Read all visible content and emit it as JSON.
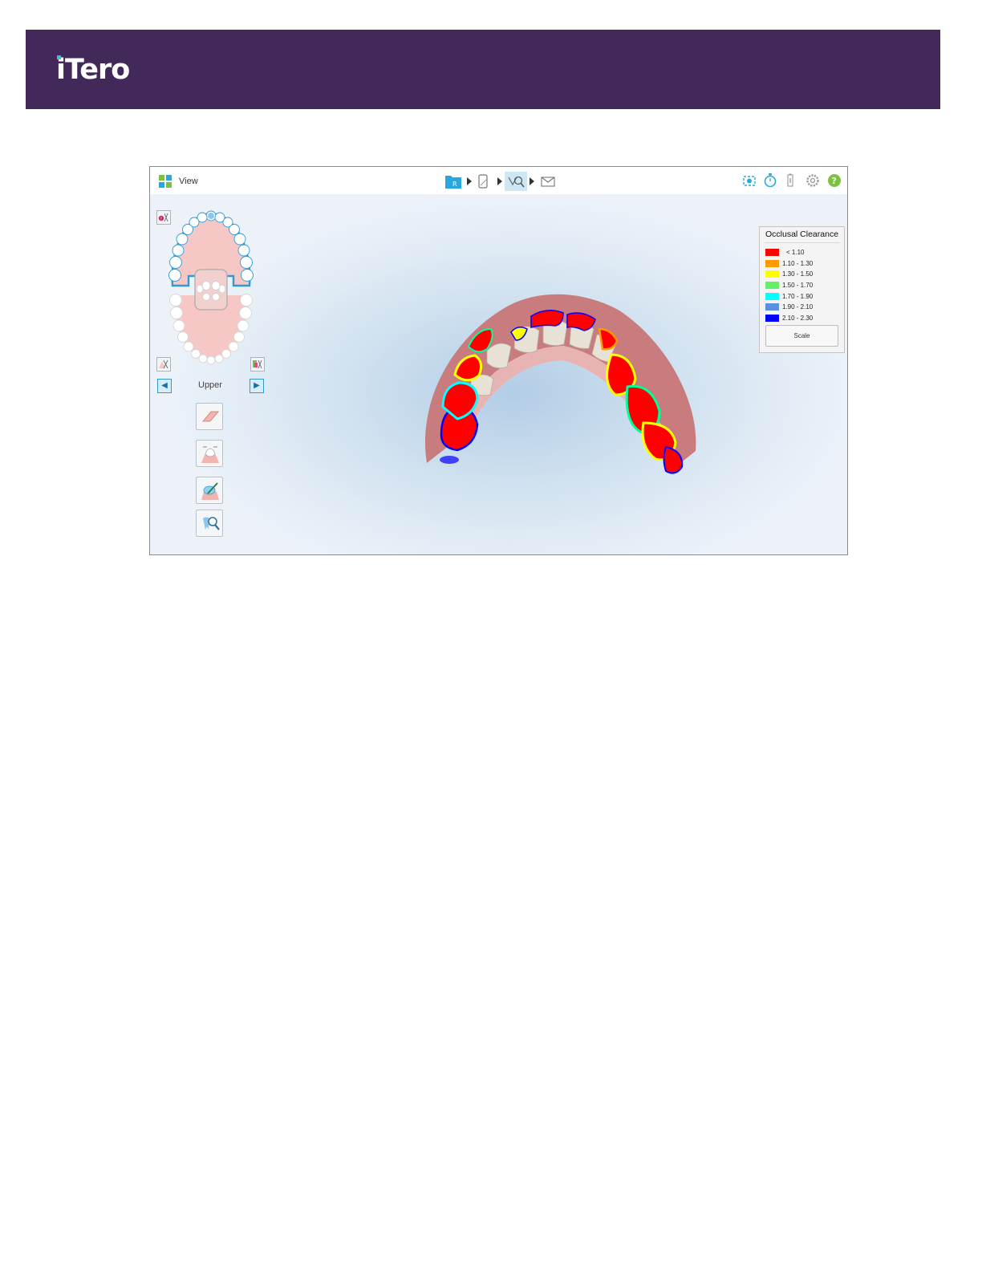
{
  "header": {
    "logo_text": "iTero",
    "background_color": "#43285a",
    "accent_color": "#2fc6d9"
  },
  "app": {
    "toolbar": {
      "view_label": "View",
      "workflow_steps": [
        "patient-folder-icon",
        "scan-icon",
        "view-tools-icon",
        "send-envelope-icon"
      ],
      "active_step": "view-tools-icon",
      "right_icons": [
        "camera-icon",
        "timer-icon",
        "battery-icon",
        "settings-gear-icon",
        "help-icon"
      ]
    },
    "jaw_navigator": {
      "jaw_label": "Upper",
      "selected_jaw": "upper"
    },
    "side_tools": [
      "eraser-tool-icon",
      "bite-view-tool-icon",
      "margin-tool-icon",
      "review-tool-icon"
    ],
    "legend": {
      "title": "Occlusal Clearance",
      "items": [
        {
          "label": "< 1.10",
          "color": "#ff0000"
        },
        {
          "label": "1.10 - 1.30",
          "color": "#ff9900"
        },
        {
          "label": "1.30 - 1.50",
          "color": "#ffff00"
        },
        {
          "label": "1.50 - 1.70",
          "color": "#66ee66"
        },
        {
          "label": "1.70 - 1.90",
          "color": "#00ffff"
        },
        {
          "label": "1.90 - 2.10",
          "color": "#5b8fe0"
        },
        {
          "label": "2.10 - 2.30",
          "color": "#0000ff"
        }
      ],
      "scale_label": "Scale"
    }
  }
}
